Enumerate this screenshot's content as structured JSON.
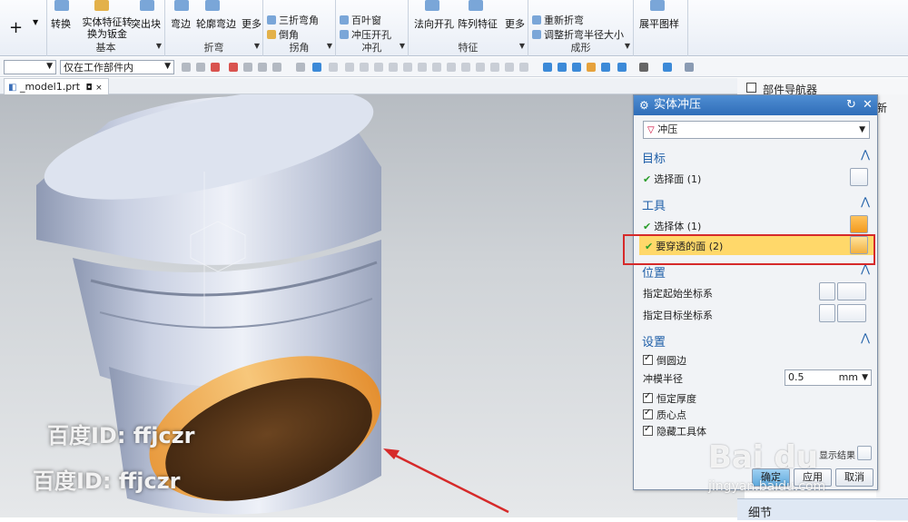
{
  "ribbon": {
    "groups": [
      {
        "title": "基本",
        "buttons": [
          "转换",
          "实体特征转换为钣金",
          "突出块"
        ]
      },
      {
        "title": "折弯",
        "buttons": [
          "弯边",
          "轮廓弯边",
          "更多"
        ]
      },
      {
        "title": "拐角",
        "items": [
          "三折弯角",
          "倒角"
        ]
      },
      {
        "title": "冲孔",
        "items": [
          "百叶窗",
          "冲压开孔"
        ]
      },
      {
        "title": "特征",
        "buttons": [
          "法向开孔",
          "阵列特征",
          "更多"
        ]
      },
      {
        "title": "成形",
        "items": [
          "重新折弯",
          "调整折弯半径大小"
        ]
      },
      {
        "title": "",
        "buttons": [
          "展平图样"
        ]
      }
    ]
  },
  "toolbar": {
    "filter_value": "",
    "scope_value": "仅在工作部件内"
  },
  "document_tab": {
    "label": "_model1.prt"
  },
  "part_navigator": {
    "label": "部件导航器",
    "partial": "新"
  },
  "dialog": {
    "title": "实体冲压",
    "type_value": "冲压",
    "sections": {
      "target": {
        "title": "目标",
        "select_face": "选择面 (1)"
      },
      "tool": {
        "title": "工具",
        "select_body": "选择体 (1)",
        "pierce_faces": "要穿透的面 (2)"
      },
      "position": {
        "title": "位置",
        "start_csys": "指定起始坐标系",
        "target_csys": "指定目标坐标系"
      },
      "settings": {
        "title": "设置",
        "fillet_edges": "倒圆边",
        "punch_radius_label": "冲模半径",
        "punch_radius_value": "0.5",
        "punch_radius_unit": "mm",
        "constant_thickness": "恒定厚度",
        "centroid": "质心点",
        "hide_tool": "隐藏工具体"
      }
    },
    "show_result": "显示结果",
    "buttons": {
      "ok": "确定",
      "apply": "应用",
      "cancel": "取消"
    }
  },
  "detail_bar": {
    "label": "细节"
  },
  "watermarks": [
    "百度ID: ffjczr",
    "百度ID: ffjczr"
  ],
  "baidu_logo": {
    "text": "Bai du",
    "domain": "jingyan.baidu.com"
  },
  "colors": {
    "highlight_row": "#ffd86a",
    "annotation_red": "#d62a2a",
    "title_blue": "#2f6db8"
  }
}
